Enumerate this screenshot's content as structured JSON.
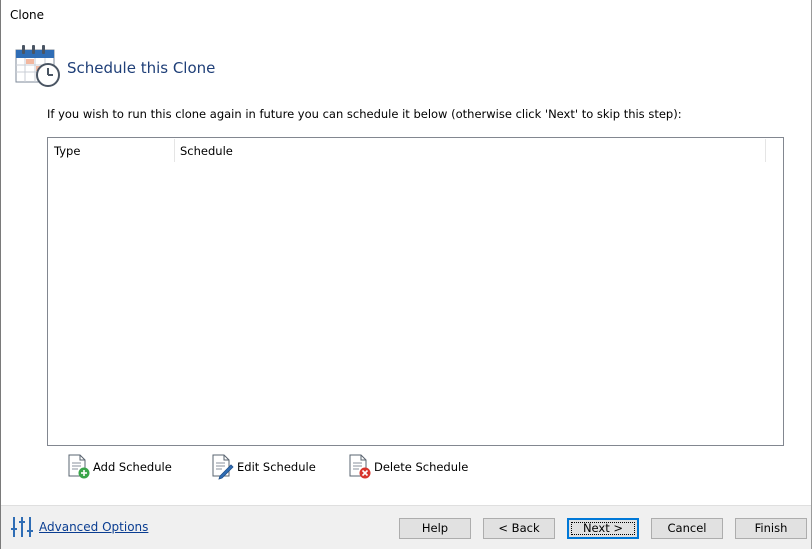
{
  "window": {
    "title": "Clone"
  },
  "page": {
    "heading": "Schedule this Clone",
    "instruction": "If you wish to run this clone again in future you can schedule it below (otherwise click 'Next' to skip this step):"
  },
  "schedule_list": {
    "columns": [
      "Type",
      "Schedule"
    ],
    "rows": []
  },
  "actions": {
    "add_label": "Add Schedule",
    "edit_label": "Edit Schedule",
    "delete_label": "Delete Schedule"
  },
  "footer": {
    "advanced_options": "Advanced Options",
    "help": "Help",
    "back": "< Back",
    "next": "Next >",
    "cancel": "Cancel",
    "finish": "Finish"
  },
  "colors": {
    "heading": "#1f3f78",
    "link": "#0a3d91",
    "default_button_border": "#0078d7",
    "add_badge": "#3aa54a",
    "delete_badge": "#d8342c"
  },
  "icons": [
    "calendar-clock-icon",
    "add-schedule-icon",
    "edit-schedule-icon",
    "delete-schedule-icon",
    "sliders-icon"
  ]
}
